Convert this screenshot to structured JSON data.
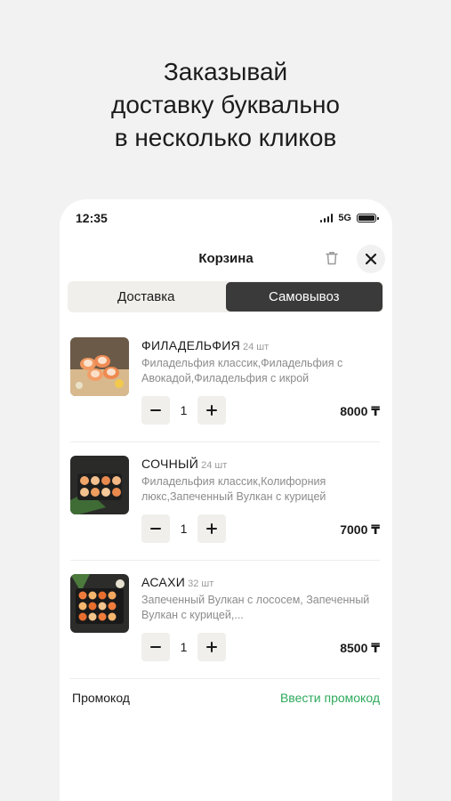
{
  "headline": [
    "Заказывай",
    "доставку буквально",
    "в несколько кликов"
  ],
  "status_bar": {
    "time": "12:35",
    "network": "5G"
  },
  "header": {
    "title": "Корзина",
    "icons": [
      "trash-icon",
      "close-icon"
    ]
  },
  "tabs": [
    {
      "label": "Доставка",
      "active": false
    },
    {
      "label": "Самовывоз",
      "active": true
    }
  ],
  "items": [
    {
      "name": "ФИЛАДЕЛЬФИЯ",
      "qty": "24 шт",
      "description": "Филадельфия классик,Филадельфия с Авокадой,Филадельфия с икрой",
      "count": "1",
      "price": "8000 ₸"
    },
    {
      "name": "СОЧНЫЙ",
      "qty": "24 шт",
      "description": "Филадельфия классик,Колифорния люкс,Запеченный Вулкан с курицей",
      "count": "1",
      "price": "7000 ₸"
    },
    {
      "name": "АСАХИ",
      "qty": "32 шт",
      "description": "Запеченный Вулкан с лососем, Запеченный Вулкан с курицей,...",
      "count": "1",
      "price": "8500 ₸"
    }
  ],
  "promo": {
    "label": "Промокод",
    "action": "Ввести промокод"
  },
  "colors": {
    "accent_green": "#2eaa5c",
    "active_tab": "#3a3a3a",
    "segment_bg": "#f1efeb"
  }
}
